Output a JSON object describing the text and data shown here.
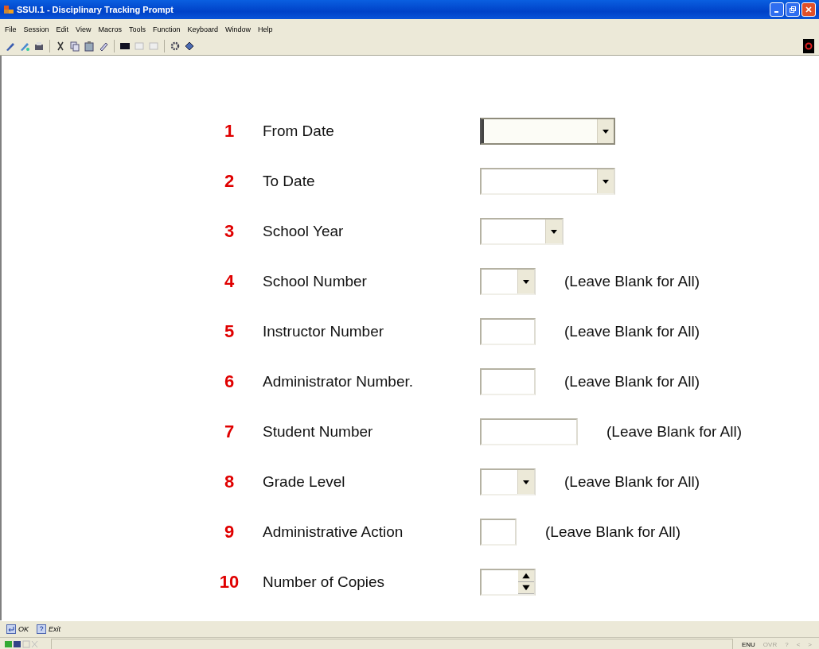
{
  "window": {
    "title": "SSUI.1 - Disciplinary Tracking Prompt"
  },
  "menu": [
    "File",
    "Session",
    "Edit",
    "View",
    "Macros",
    "Tools",
    "Function",
    "Keyboard",
    "Window",
    "Help"
  ],
  "form": [
    {
      "number": "1",
      "label": "From Date",
      "kind": "dropdown",
      "focused": true
    },
    {
      "number": "2",
      "label": "To Date",
      "kind": "dropdown",
      "focused": false
    },
    {
      "number": "3",
      "label": "School Year",
      "kind": "dropdown",
      "focused": false
    },
    {
      "number": "4",
      "label": "School Number",
      "kind": "dropdown",
      "focused": false,
      "note": "(Leave Blank for All)"
    },
    {
      "number": "5",
      "label": "Instructor Number",
      "kind": "text",
      "focused": false,
      "note": "(Leave Blank for All)"
    },
    {
      "number": "6",
      "label": "Administrator Number.",
      "kind": "text",
      "focused": false,
      "note": "(Leave Blank for All)"
    },
    {
      "number": "7",
      "label": "Student Number",
      "kind": "text",
      "focused": false,
      "note": "(Leave Blank for All)"
    },
    {
      "number": "8",
      "label": "Grade Level",
      "kind": "dropdown",
      "focused": false,
      "note": "(Leave Blank for All)"
    },
    {
      "number": "9",
      "label": "Administrative Action",
      "kind": "text",
      "focused": false,
      "note": "(Leave Blank for All)"
    },
    {
      "number": "10",
      "label": "Number of Copies",
      "kind": "spinner",
      "focused": false
    }
  ],
  "actions": [
    {
      "label": "OK",
      "kind": "enter"
    },
    {
      "label": "Exit",
      "kind": "help"
    }
  ],
  "status_bar": [
    {
      "text": "ENU",
      "disabled": false
    },
    {
      "text": "OVR",
      "disabled": true
    },
    {
      "text": "?",
      "disabled": true
    },
    {
      "text": "<",
      "disabled": true
    },
    {
      "text": ">",
      "disabled": true
    }
  ]
}
